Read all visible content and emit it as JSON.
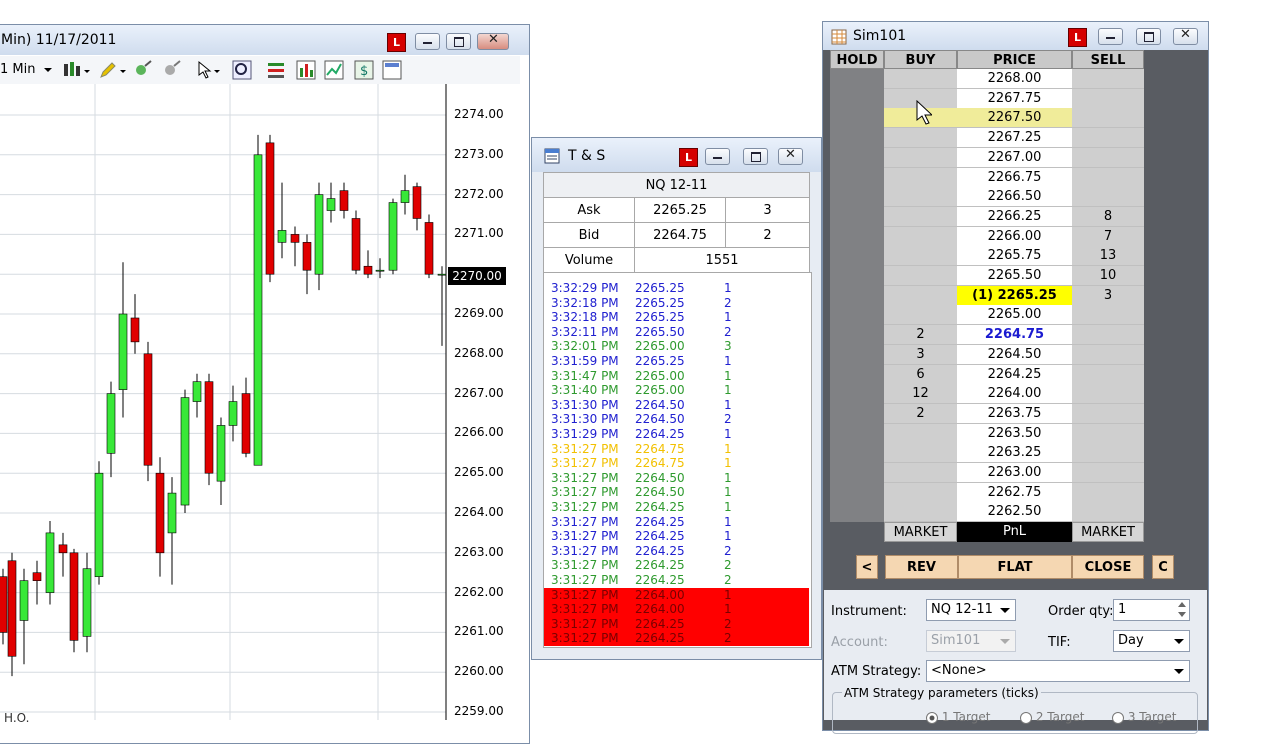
{
  "chart_window": {
    "title": "Min)  11/17/2011",
    "interval": "1 Min",
    "last_price_tag": "2270.00",
    "bottom_label": "H.O.",
    "price_labels": [
      "2274.00",
      "2273.00",
      "2272.00",
      "2271.00",
      "2270.00",
      "2269.00",
      "2268.00",
      "2267.00",
      "2266.00",
      "2265.00",
      "2264.00",
      "2263.00",
      "2262.00",
      "2261.00",
      "2260.00",
      "2259.00"
    ],
    "up_color": "#38e838",
    "down_color": "#e00000"
  },
  "ts_window": {
    "title": "T & S",
    "instrument": "NQ 12-11",
    "ask_label": "Ask",
    "ask_price": "2265.25",
    "ask_size": "3",
    "bid_label": "Bid",
    "bid_price": "2264.75",
    "bid_size": "2",
    "volume_label": "Volume",
    "volume": "1551",
    "trades": [
      {
        "time": "3:32:29 PM",
        "price": "2265.25",
        "size": "1",
        "color": "#2020d0",
        "bg": ""
      },
      {
        "time": "3:32:18 PM",
        "price": "2265.25",
        "size": "2",
        "color": "#2020d0",
        "bg": ""
      },
      {
        "time": "3:32:18 PM",
        "price": "2265.25",
        "size": "1",
        "color": "#2020d0",
        "bg": ""
      },
      {
        "time": "3:32:11 PM",
        "price": "2265.50",
        "size": "2",
        "color": "#2020d0",
        "bg": ""
      },
      {
        "time": "3:32:01 PM",
        "price": "2265.00",
        "size": "3",
        "color": "#2e9a2e",
        "bg": ""
      },
      {
        "time": "3:31:59 PM",
        "price": "2265.25",
        "size": "1",
        "color": "#2020d0",
        "bg": ""
      },
      {
        "time": "3:31:47 PM",
        "price": "2265.00",
        "size": "1",
        "color": "#2e9a2e",
        "bg": ""
      },
      {
        "time": "3:31:40 PM",
        "price": "2265.00",
        "size": "1",
        "color": "#2e9a2e",
        "bg": ""
      },
      {
        "time": "3:31:30 PM",
        "price": "2264.50",
        "size": "1",
        "color": "#2020d0",
        "bg": ""
      },
      {
        "time": "3:31:30 PM",
        "price": "2264.50",
        "size": "2",
        "color": "#2020d0",
        "bg": ""
      },
      {
        "time": "3:31:29 PM",
        "price": "2264.25",
        "size": "1",
        "color": "#2020d0",
        "bg": ""
      },
      {
        "time": "3:31:27 PM",
        "price": "2264.75",
        "size": "1",
        "color": "#f2c000",
        "bg": ""
      },
      {
        "time": "3:31:27 PM",
        "price": "2264.75",
        "size": "1",
        "color": "#f2c000",
        "bg": ""
      },
      {
        "time": "3:31:27 PM",
        "price": "2264.50",
        "size": "1",
        "color": "#2e9a2e",
        "bg": ""
      },
      {
        "time": "3:31:27 PM",
        "price": "2264.50",
        "size": "1",
        "color": "#2e9a2e",
        "bg": ""
      },
      {
        "time": "3:31:27 PM",
        "price": "2264.25",
        "size": "1",
        "color": "#2e9a2e",
        "bg": ""
      },
      {
        "time": "3:31:27 PM",
        "price": "2264.25",
        "size": "1",
        "color": "#2020d0",
        "bg": ""
      },
      {
        "time": "3:31:27 PM",
        "price": "2264.25",
        "size": "1",
        "color": "#2020d0",
        "bg": ""
      },
      {
        "time": "3:31:27 PM",
        "price": "2264.25",
        "size": "2",
        "color": "#2020d0",
        "bg": ""
      },
      {
        "time": "3:31:27 PM",
        "price": "2264.25",
        "size": "2",
        "color": "#2e9a2e",
        "bg": ""
      },
      {
        "time": "3:31:27 PM",
        "price": "2264.25",
        "size": "2",
        "color": "#2e9a2e",
        "bg": ""
      },
      {
        "time": "3:31:27 PM",
        "price": "2264.00",
        "size": "1",
        "color": "#7a0000",
        "bg": "#ff0000"
      },
      {
        "time": "3:31:27 PM",
        "price": "2264.00",
        "size": "1",
        "color": "#7a0000",
        "bg": "#ff0000"
      },
      {
        "time": "3:31:27 PM",
        "price": "2264.25",
        "size": "2",
        "color": "#7a0000",
        "bg": "#ff0000"
      },
      {
        "time": "3:31:27 PM",
        "price": "2264.25",
        "size": "2",
        "color": "#7a0000",
        "bg": "#ff0000"
      }
    ]
  },
  "dom_window": {
    "title": "Sim101",
    "headers": {
      "hold": "HOLD",
      "buy": "BUY",
      "price": "PRICE",
      "sell": "SELL"
    },
    "rows": [
      {
        "buy": "",
        "price": "2268.00",
        "sell": "",
        "style": ""
      },
      {
        "buy": "",
        "price": "2267.75",
        "sell": "",
        "style": ""
      },
      {
        "buy": "",
        "price": "2267.50",
        "sell": "",
        "style": "hover"
      },
      {
        "buy": "",
        "price": "2267.25",
        "sell": "",
        "style": ""
      },
      {
        "buy": "",
        "price": "2267.00",
        "sell": "",
        "style": ""
      },
      {
        "buy": "",
        "price": "2266.75",
        "sell": "",
        "style": ""
      },
      {
        "buy": "",
        "price": "2266.50",
        "sell": "",
        "style": ""
      },
      {
        "buy": "",
        "price": "2266.25",
        "sell": "8",
        "style": ""
      },
      {
        "buy": "",
        "price": "2266.00",
        "sell": "7",
        "style": ""
      },
      {
        "buy": "",
        "price": "2265.75",
        "sell": "13",
        "style": ""
      },
      {
        "buy": "",
        "price": "2265.50",
        "sell": "10",
        "style": ""
      },
      {
        "buy": "",
        "price": "(1) 2265.25",
        "sell": "3",
        "style": "last"
      },
      {
        "buy": "",
        "price": "2265.00",
        "sell": "",
        "style": ""
      },
      {
        "buy": "2",
        "price": "2264.75",
        "sell": "",
        "style": "bid"
      },
      {
        "buy": "3",
        "price": "2264.50",
        "sell": "",
        "style": ""
      },
      {
        "buy": "6",
        "price": "2264.25",
        "sell": "",
        "style": ""
      },
      {
        "buy": "12",
        "price": "2264.00",
        "sell": "",
        "style": ""
      },
      {
        "buy": "2",
        "price": "2263.75",
        "sell": "",
        "style": ""
      },
      {
        "buy": "",
        "price": "2263.50",
        "sell": "",
        "style": ""
      },
      {
        "buy": "",
        "price": "2263.25",
        "sell": "",
        "style": ""
      },
      {
        "buy": "",
        "price": "2263.00",
        "sell": "",
        "style": ""
      },
      {
        "buy": "",
        "price": "2262.75",
        "sell": "",
        "style": ""
      },
      {
        "buy": "",
        "price": "2262.50",
        "sell": "",
        "style": ""
      }
    ],
    "market_buy": "MARKET",
    "pnl": "PnL",
    "market_sell": "MARKET",
    "btn_left": "<",
    "btn_rev": "REV",
    "btn_flat": "FLAT",
    "btn_close": "CLOSE",
    "btn_c": "C",
    "instrument_label": "Instrument:",
    "instrument_value": "NQ 12-11",
    "order_qty_label": "Order qty:",
    "order_qty_value": "1",
    "account_label": "Account:",
    "account_value": "Sim101",
    "tif_label": "TIF:",
    "tif_value": "Day",
    "atm_label": "ATM Strategy:",
    "atm_value": "<None>",
    "atm_params_label": "ATM Strategy parameters (ticks)",
    "targets": [
      "1 Target",
      "2 Target",
      "3 Target"
    ]
  }
}
